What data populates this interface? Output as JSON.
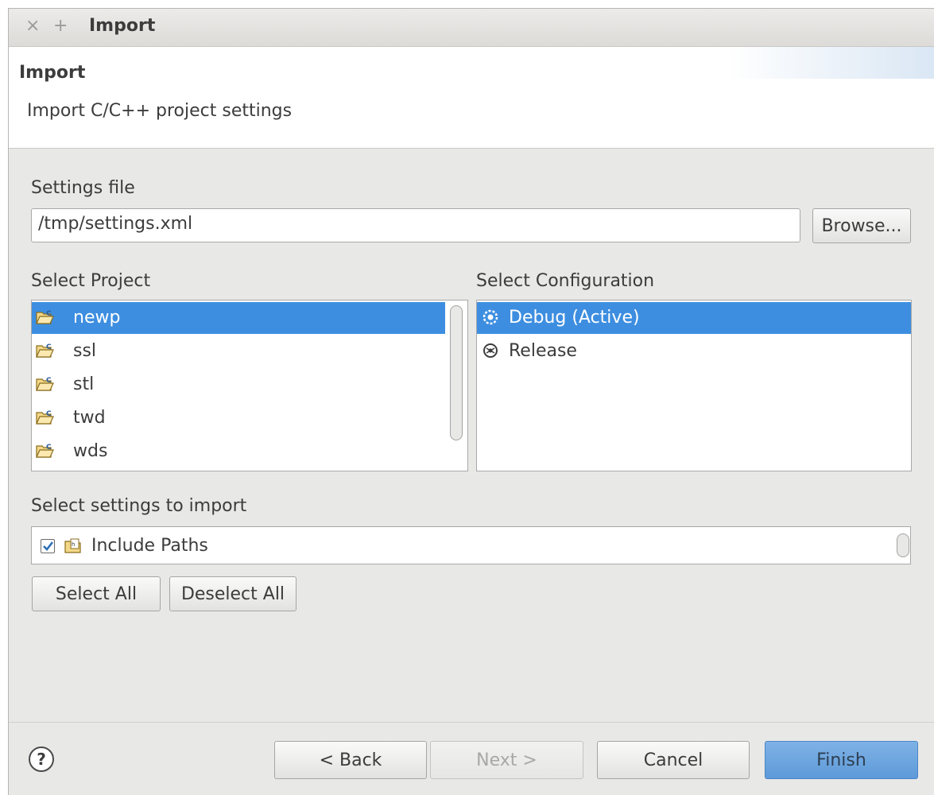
{
  "window": {
    "title": "Import",
    "close_glyph": "×",
    "add_glyph": "+"
  },
  "banner": {
    "title": "Import",
    "description": "Import C/C++ project settings"
  },
  "settings_file": {
    "label": "Settings file",
    "value": "/tmp/settings.xml",
    "browse_label": "Browse..."
  },
  "projects": {
    "label": "Select Project",
    "items": [
      {
        "name": "newp",
        "icon": "c-project-folder-icon",
        "selected": true
      },
      {
        "name": "ssl",
        "icon": "c-project-folder-icon",
        "selected": false
      },
      {
        "name": "stl",
        "icon": "c-project-folder-icon",
        "selected": false
      },
      {
        "name": "twd",
        "icon": "c-project-folder-icon",
        "selected": false
      },
      {
        "name": "wds",
        "icon": "c-project-folder-icon",
        "selected": false
      }
    ]
  },
  "configurations": {
    "label": "Select Configuration",
    "items": [
      {
        "name": "Debug (Active)",
        "icon": "build-config-icon",
        "selected": true
      },
      {
        "name": "Release",
        "icon": "build-config-icon",
        "selected": false
      }
    ]
  },
  "settings_to_import": {
    "label": "Select settings to import",
    "items": [
      {
        "name": "Include Paths",
        "icon": "include-paths-icon",
        "checked": true
      }
    ],
    "select_all_label": "Select All",
    "deselect_all_label": "Deselect All"
  },
  "footer": {
    "help_glyph": "?",
    "back_label": "< Back",
    "next_label": "Next >",
    "cancel_label": "Cancel",
    "finish_label": "Finish"
  },
  "colors": {
    "selection": "#3d8ee0",
    "primary_button": "#6ca6df",
    "dialog_background": "#e8e8e7"
  }
}
